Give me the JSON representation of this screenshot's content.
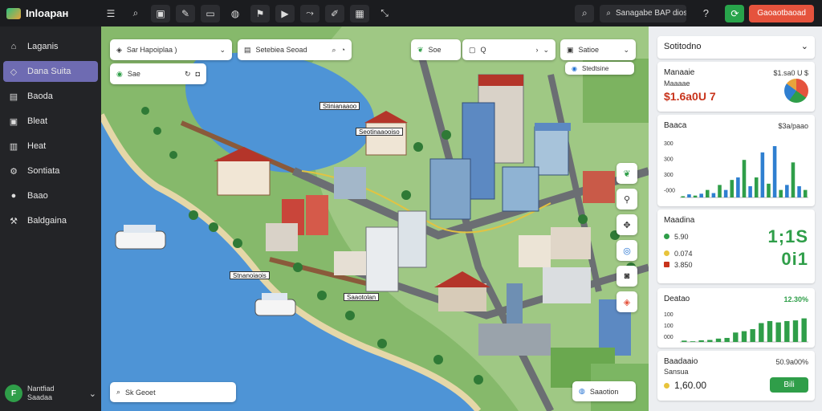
{
  "app": {
    "name": "Inloapaн"
  },
  "topbar": {
    "tools": [
      "menu-icon",
      "search-icon",
      "layers-icon",
      "pen-icon",
      "ruler-icon",
      "globe-icon",
      "pin-icon",
      "play-icon",
      "route-icon",
      "draw-icon",
      "grid-icon",
      "expand-icon"
    ],
    "search_text": "Sanagabe BAP dios",
    "cta_label": "Gaoaotbaoad"
  },
  "sidebar": {
    "items": [
      {
        "label": "Laganis",
        "icon": "home-icon"
      },
      {
        "label": "Dana Suita",
        "icon": "layers-icon"
      },
      {
        "label": "Baoda",
        "icon": "book-icon"
      },
      {
        "label": "Bleat",
        "icon": "briefcase-icon"
      },
      {
        "label": "Heat",
        "icon": "chart-icon"
      },
      {
        "label": "Sontiata",
        "icon": "settings-icon"
      },
      {
        "label": "Baao",
        "icon": "pin-icon"
      },
      {
        "label": "Baldgaina",
        "icon": "tools-icon"
      }
    ],
    "active_index": 1,
    "profile": {
      "initial": "F",
      "name": "Nantfiad",
      "role": "Saadaa"
    }
  },
  "map": {
    "chip1": {
      "text": "Sar Hapoiplaa )"
    },
    "chip2": {
      "text": "Setebiea Seoad"
    },
    "chip3": {
      "text": "Sae"
    },
    "chip4": {
      "text": "Soe"
    },
    "chip5": {
      "text": "Q"
    },
    "chip6": {
      "text": "Satioe"
    },
    "chip7": {
      "text": "Stedtsine"
    },
    "labels": [
      "Stinianaaoo",
      "Seotinaaooiso",
      "Stnanoiaois",
      "Saaotolan"
    ],
    "search_placeholder": "Sk Geoet",
    "bottom_chip": "Saaotion"
  },
  "panel": {
    "header": "Sotitodno",
    "card1": {
      "title": "Manaaie",
      "sub": "Maaaae",
      "value": "$1.6a0U 7",
      "right": "$1.sa0 U $"
    },
    "card2": {
      "title": "Baaca",
      "right": "$3a/paao",
      "y_ticks": [
        "300",
        "300",
        "300",
        "-000"
      ]
    },
    "card3": {
      "title": "Maadina",
      "big": "1;1S",
      "row1": "5.90",
      "row2": "0.074",
      "row3": "3.850",
      "big2": "0i1"
    },
    "card4": {
      "title": "Deatao",
      "right": "12.30%",
      "y_ticks": [
        "100",
        "100",
        "000"
      ]
    },
    "card5": {
      "title": "Baadaaio",
      "sub": "Sansua",
      "value": "1,60.00",
      "right": "50.9a00%",
      "button": "Bili"
    }
  },
  "colors": {
    "accent": "#6e6bb2",
    "green": "#2f9e49",
    "red": "#e5533d",
    "blue": "#2f7fd0"
  },
  "chart_data": [
    {
      "type": "bar",
      "title": "Baaca",
      "series": [
        {
          "values": [
            0.02,
            0.05,
            0.03,
            0.06,
            0.12,
            0.07,
            0.2,
            0.12,
            0.28,
            0.32,
            0.6,
            0.18,
            0.32,
            0.72,
            0.22,
            0.82,
            0.12,
            0.2,
            0.56,
            0.18,
            0.12
          ]
        }
      ],
      "ylim": [
        0,
        1
      ]
    },
    {
      "type": "bar",
      "title": "Deatao",
      "series": [
        {
          "values": [
            0.04,
            0.02,
            0.05,
            0.06,
            0.1,
            0.12,
            0.28,
            0.32,
            0.38,
            0.56,
            0.62,
            0.58,
            0.62,
            0.64,
            0.7
          ]
        }
      ],
      "ylim": [
        0,
        1
      ]
    }
  ]
}
